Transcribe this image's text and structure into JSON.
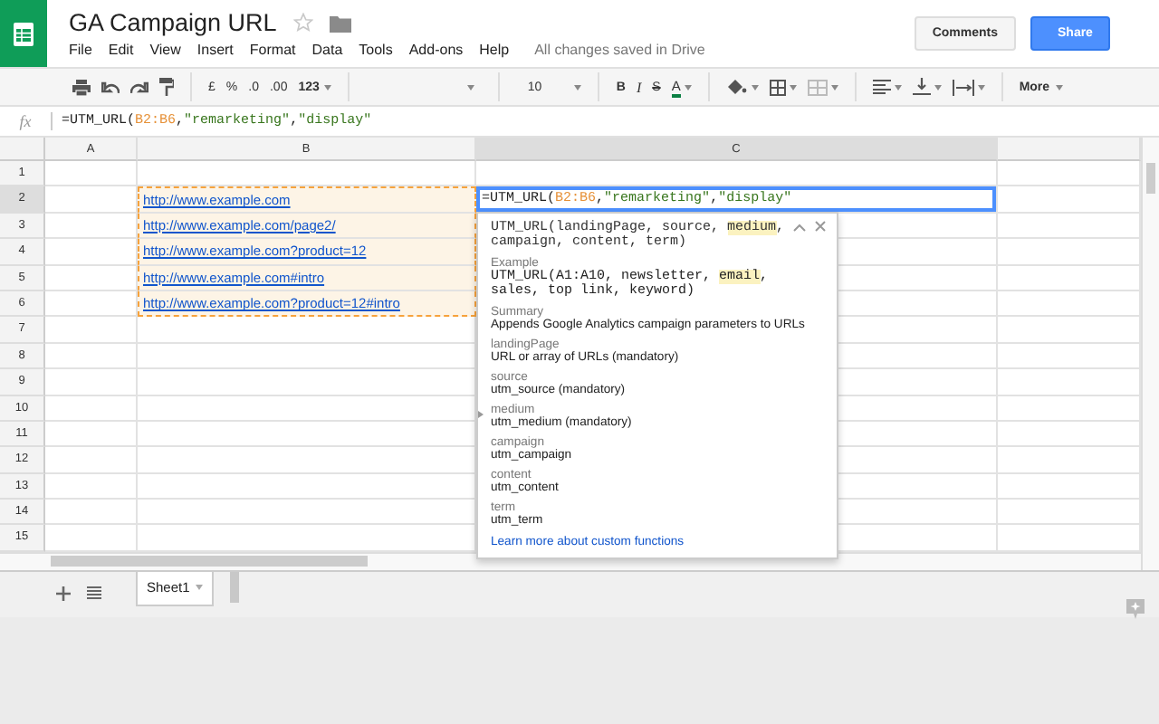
{
  "app": {
    "title": "GA Campaign URL",
    "starred": false,
    "menu": [
      "File",
      "Edit",
      "View",
      "Insert",
      "Format",
      "Data",
      "Tools",
      "Add-ons",
      "Help"
    ],
    "status": "All changes saved in Drive",
    "comments": "Comments",
    "share": "Share"
  },
  "toolbar": [
    {
      "kind": "print"
    },
    {
      "kind": "undo"
    },
    {
      "kind": "redo"
    },
    {
      "kind": "paint"
    },
    {
      "kind": "sep"
    },
    {
      "kind": "text",
      "label": "£"
    },
    {
      "kind": "text",
      "label": "%"
    },
    {
      "kind": "text",
      "label": ".0"
    },
    {
      "kind": "text",
      "label": ".00"
    },
    {
      "kind": "menu",
      "label": "123"
    },
    {
      "kind": "sep"
    },
    {
      "kind": "font"
    },
    {
      "kind": "sep"
    },
    {
      "kind": "size",
      "label": "10"
    },
    {
      "kind": "sep"
    },
    {
      "kind": "bold",
      "label": "B"
    },
    {
      "kind": "italic",
      "label": "I"
    },
    {
      "kind": "strike",
      "label": "S"
    },
    {
      "kind": "color",
      "label": "A"
    },
    {
      "kind": "sep"
    },
    {
      "kind": "fill"
    },
    {
      "kind": "borders"
    },
    {
      "kind": "merge"
    },
    {
      "kind": "sep"
    },
    {
      "kind": "align"
    },
    {
      "kind": "valign"
    },
    {
      "kind": "wrap"
    },
    {
      "kind": "sep"
    },
    {
      "kind": "menu",
      "label": "More"
    }
  ],
  "formula_bar": {
    "label": "fx",
    "formula": [
      {
        "text": "=UTM_URL(",
        "kind": "plain"
      },
      {
        "text": "B2:B6",
        "kind": "range"
      },
      {
        "text": ",",
        "kind": "plain"
      },
      {
        "text": "\"remarketing\"",
        "kind": "string"
      },
      {
        "text": ",",
        "kind": "plain"
      },
      {
        "text": "\"display\"",
        "kind": "string"
      }
    ]
  },
  "columns": [
    {
      "label": "A",
      "selected": false
    },
    {
      "label": "B",
      "selected": false
    },
    {
      "label": "C",
      "selected": true
    },
    {
      "selected": false
    }
  ],
  "rows": [
    {
      "number": "1",
      "selected": false,
      "in_range": false
    },
    {
      "number": "2",
      "selected": true,
      "in_range": true,
      "b": "http://www.example.com",
      "c_formula": [
        {
          "text": "=UTM_URL(",
          "kind": "plain"
        },
        {
          "text": "B2:B6",
          "kind": "range"
        },
        {
          "text": ",",
          "kind": "plain"
        },
        {
          "text": "\"remarketing\"",
          "kind": "string"
        },
        {
          "text": ",",
          "kind": "plain"
        },
        {
          "text": "\"display\"",
          "kind": "string"
        }
      ]
    },
    {
      "number": "3",
      "selected": false,
      "in_range": true,
      "b": "http://www.example.com/page2/"
    },
    {
      "number": "4",
      "selected": false,
      "in_range": true,
      "b": "http://www.example.com?product=12"
    },
    {
      "number": "5",
      "selected": false,
      "in_range": true,
      "b": "http://www.example.com#intro"
    },
    {
      "number": "6",
      "selected": false,
      "in_range": true,
      "b": "http://www.example.com?product=12#intro"
    },
    {
      "number": "7",
      "selected": false,
      "in_range": false
    },
    {
      "number": "8",
      "selected": false,
      "in_range": false
    },
    {
      "number": "9",
      "selected": false,
      "in_range": false
    },
    {
      "number": "10",
      "selected": false,
      "in_range": false
    },
    {
      "number": "11",
      "selected": false,
      "in_range": false
    },
    {
      "number": "12",
      "selected": false,
      "in_range": false
    },
    {
      "number": "13",
      "selected": false,
      "in_range": false
    },
    {
      "number": "14",
      "selected": false,
      "in_range": false
    },
    {
      "number": "15",
      "selected": false,
      "in_range": false
    }
  ],
  "popup": {
    "signature": [
      {
        "text": "UTM_URL(landingPage, source, ",
        "highlighted": false
      },
      {
        "text": "medium",
        "highlighted": true
      },
      {
        "text": ", campaign, content, term)",
        "highlighted": false
      }
    ],
    "example_label": "Example",
    "example": [
      {
        "text": "UTM_URL(A1:A10, newsletter, ",
        "highlighted": false
      },
      {
        "text": "email",
        "highlighted": true
      },
      {
        "text": ", sales, top link, keyword)",
        "highlighted": false
      }
    ],
    "sections": [
      {
        "label": "Summary",
        "text": "Appends Google Analytics campaign parameters to URLs",
        "current": false
      },
      {
        "label": "landingPage",
        "text": "URL or array of URLs (mandatory)",
        "current": false
      },
      {
        "label": "source",
        "text": "utm_source (mandatory)",
        "current": false
      },
      {
        "label": "medium",
        "text": "utm_medium (mandatory)",
        "current": true
      },
      {
        "label": "campaign",
        "text": "utm_campaign",
        "current": false
      },
      {
        "label": "content",
        "text": "utm_content",
        "current": false
      },
      {
        "label": "term",
        "text": "utm_term",
        "current": false
      }
    ],
    "link": "Learn more about custom functions"
  },
  "sheets": [
    {
      "name": "Sheet1",
      "selected": true
    }
  ]
}
